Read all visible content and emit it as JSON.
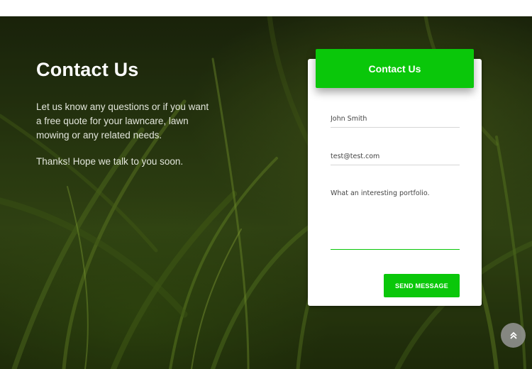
{
  "intro": {
    "title": "Contact Us",
    "paragraph": "Let us know any questions or if you want a free quote for your lawncare, lawn mowing or any related needs.",
    "closing": "Thanks! Hope we talk to you soon."
  },
  "form": {
    "header": "Contact Us",
    "name_value": "John Smith",
    "email_value": "test@test.com",
    "message_value": "What an interesting portfolio.",
    "submit_label": "SEND MESSAGE"
  },
  "colors": {
    "accent": "#0ac70a",
    "card": "#ffffff",
    "scroll_button": "#969696"
  },
  "icons": {
    "scroll_top": "double-chevron-up-icon"
  }
}
